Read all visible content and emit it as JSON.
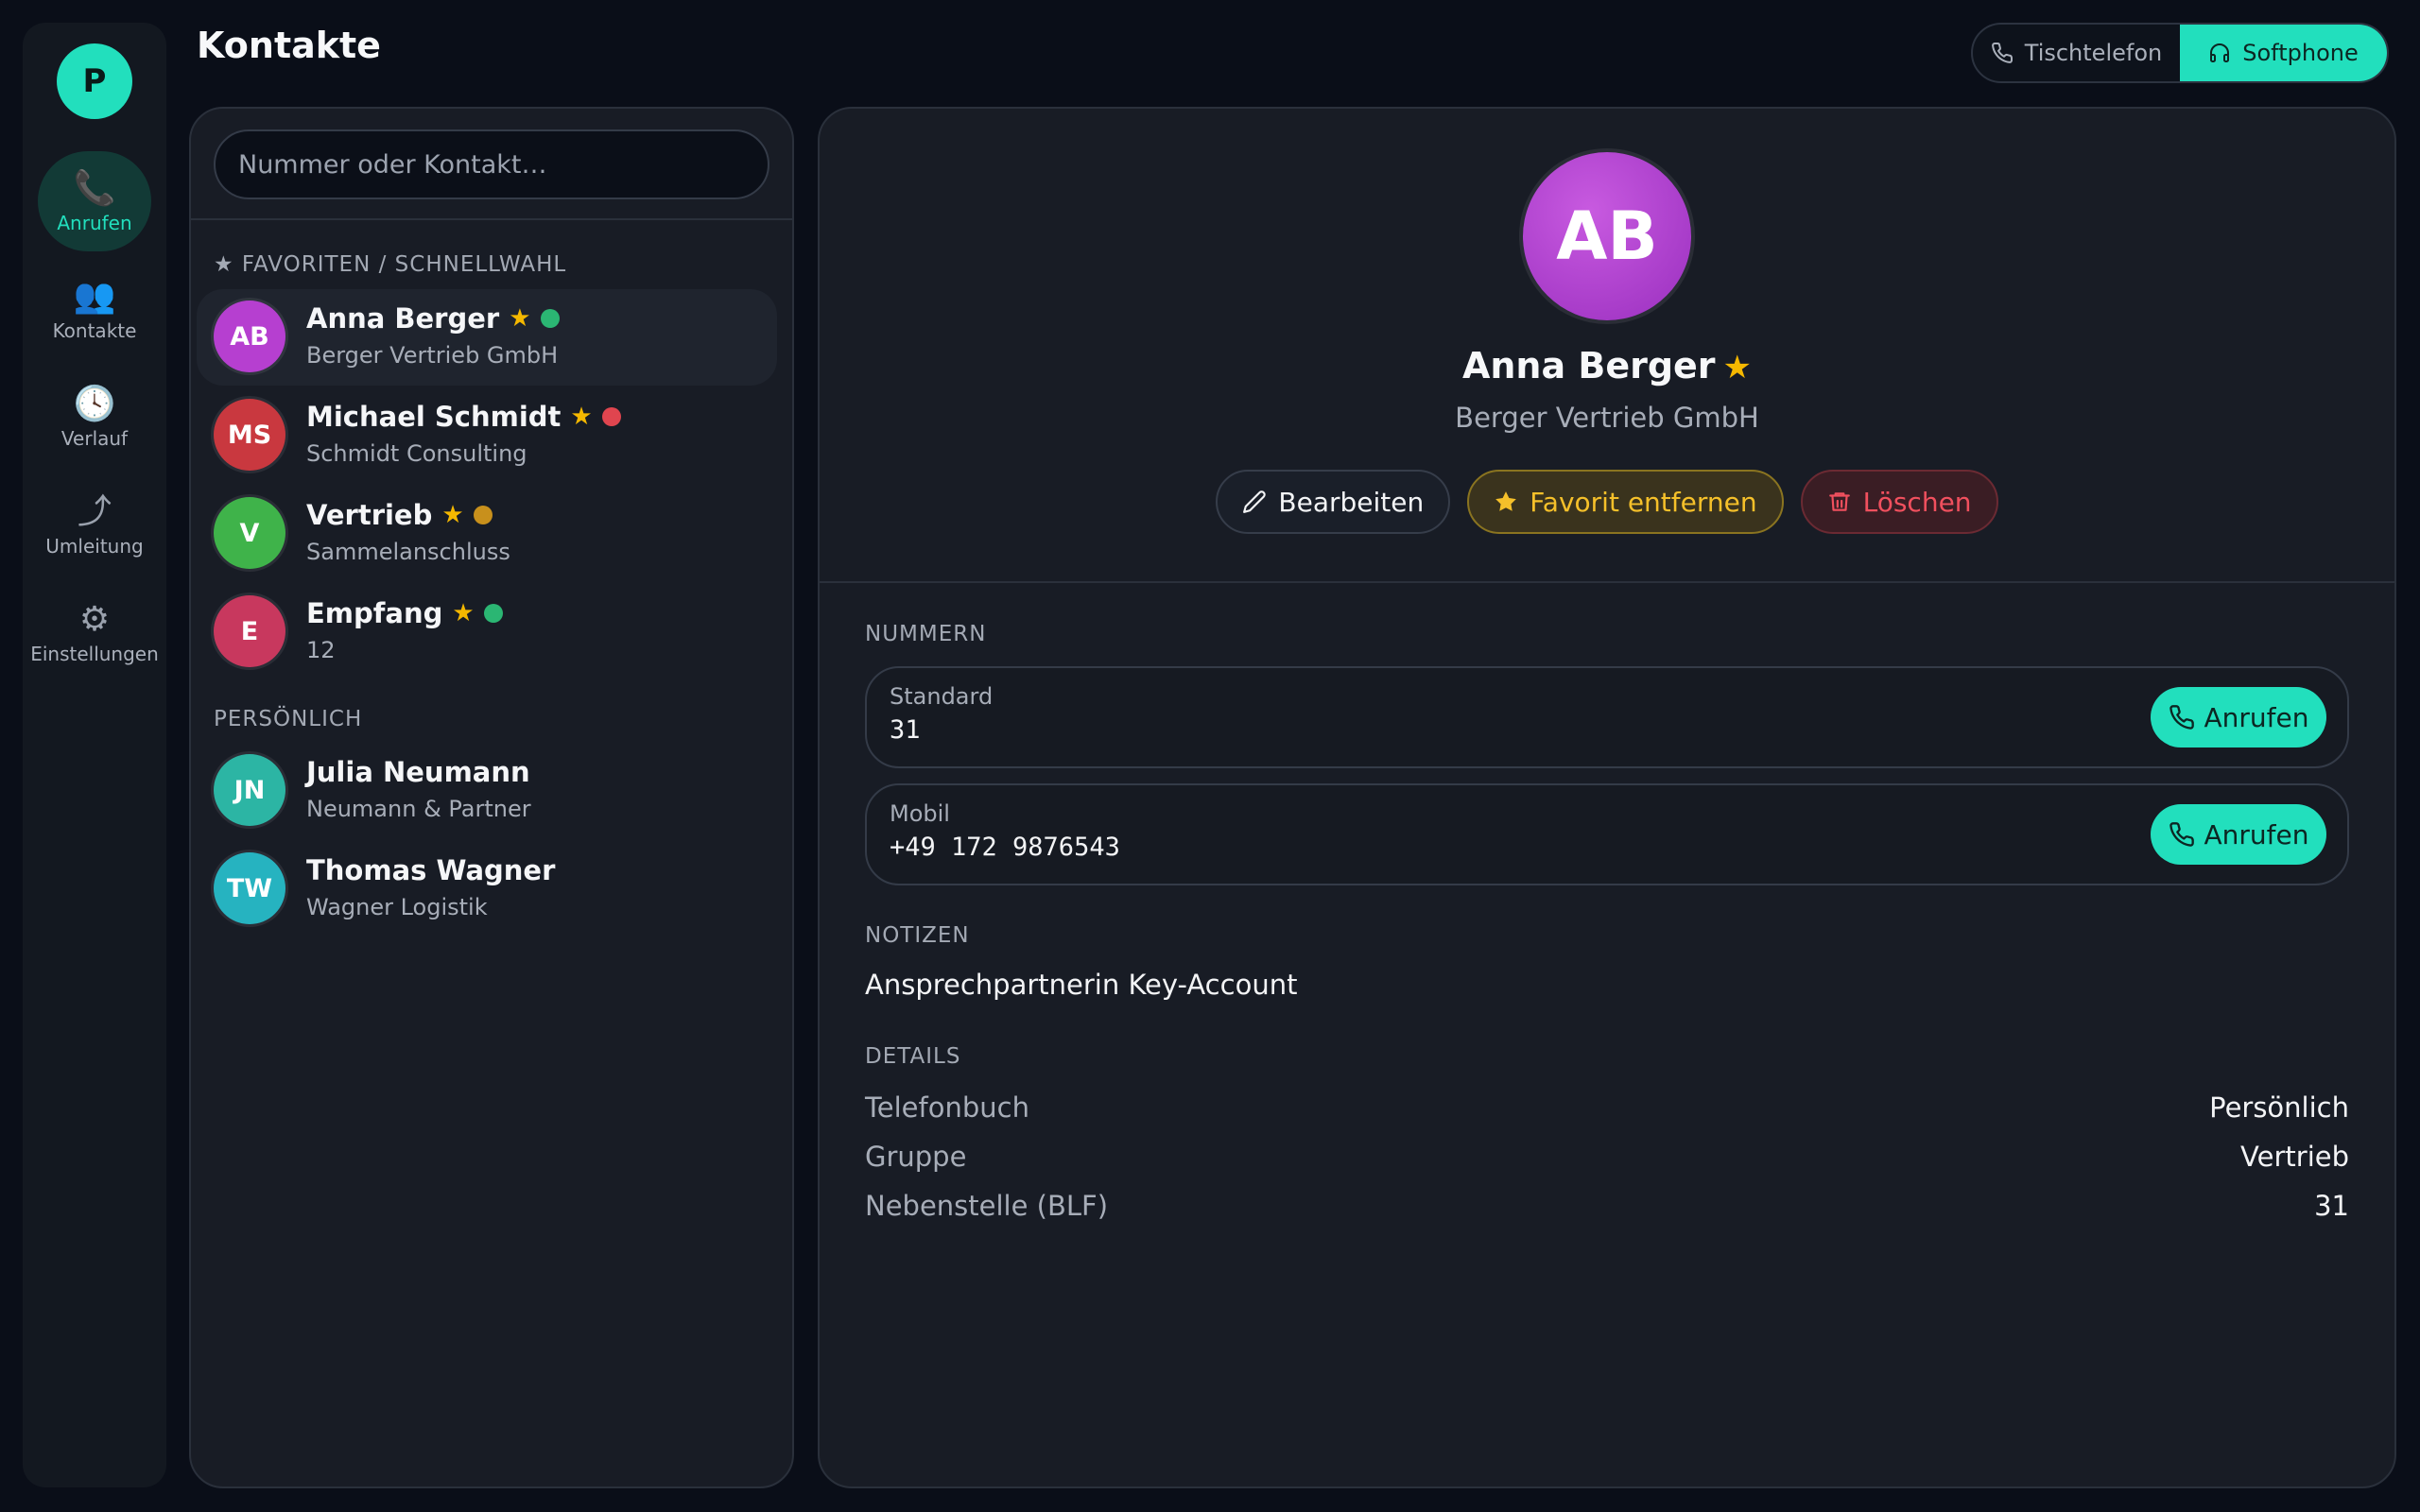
{
  "app": {
    "logo_letter": "P",
    "page_title": "Kontakte"
  },
  "nav": [
    {
      "label": "Anrufen",
      "icon": "📞",
      "active": true
    },
    {
      "label": "Kontakte",
      "icon": "👥"
    },
    {
      "label": "Verlauf",
      "icon": "🕓"
    },
    {
      "label": "Umleitung",
      "icon": "⤴"
    },
    {
      "label": "Einstellungen",
      "icon": "⚙"
    }
  ],
  "mode": {
    "desk": "Tischtelefon",
    "soft": "Softphone",
    "selected": "Softphone"
  },
  "search": {
    "placeholder": "Nummer oder Kontakt…"
  },
  "sections": {
    "favorites": "★ FAVORITEN / SCHNELLWAHL",
    "personal": "PERSÖNLICH"
  },
  "favorites": [
    {
      "initials": "AB",
      "name": "Anna Berger",
      "sub": "Berger Vertrieb GmbH",
      "status": "#2bb673",
      "color": "#b63fd0",
      "selected": true
    },
    {
      "initials": "MS",
      "name": "Michael Schmidt",
      "sub": "Schmidt Consulting",
      "status": "#e0454f",
      "color": "#c9383f"
    },
    {
      "initials": "V",
      "name": "Vertrieb",
      "sub": "Sammelanschluss",
      "status": "#c8901c",
      "color": "#3fb34a"
    },
    {
      "initials": "E",
      "name": "Empfang",
      "sub": "12",
      "status": "#2bb673",
      "color": "#c8385e"
    }
  ],
  "personal": [
    {
      "initials": "JN",
      "name": "Julia Neumann",
      "sub": "Neumann & Partner",
      "color": "#2cb5a4"
    },
    {
      "initials": "TW",
      "name": "Thomas Wagner",
      "sub": "Wagner Logistik",
      "color": "#26b3c0"
    }
  ],
  "detail": {
    "initials": "AB",
    "name": "Anna Berger",
    "company": "Berger Vertrieb GmbH",
    "actions": {
      "edit": "Bearbeiten",
      "fav": "Favorit entfernen",
      "del": "Löschen"
    },
    "numbers_title": "NUMMERN",
    "numbers": [
      {
        "label": "Standard",
        "value": "31",
        "call": "Anrufen"
      },
      {
        "label": "Mobil",
        "value": "+49 172 9876543",
        "call": "Anrufen"
      }
    ],
    "notes_title": "NOTIZEN",
    "notes": "Ansprechpartnerin Key-Account",
    "details_title": "DETAILS",
    "details": [
      {
        "k": "Telefonbuch",
        "v": "Persönlich"
      },
      {
        "k": "Gruppe",
        "v": "Vertrieb"
      },
      {
        "k": "Nebenstelle (BLF)",
        "v": "31"
      }
    ]
  },
  "colors": {
    "accent": "#22dfbd",
    "star": "#f5b800",
    "danger": "#f0505e"
  }
}
